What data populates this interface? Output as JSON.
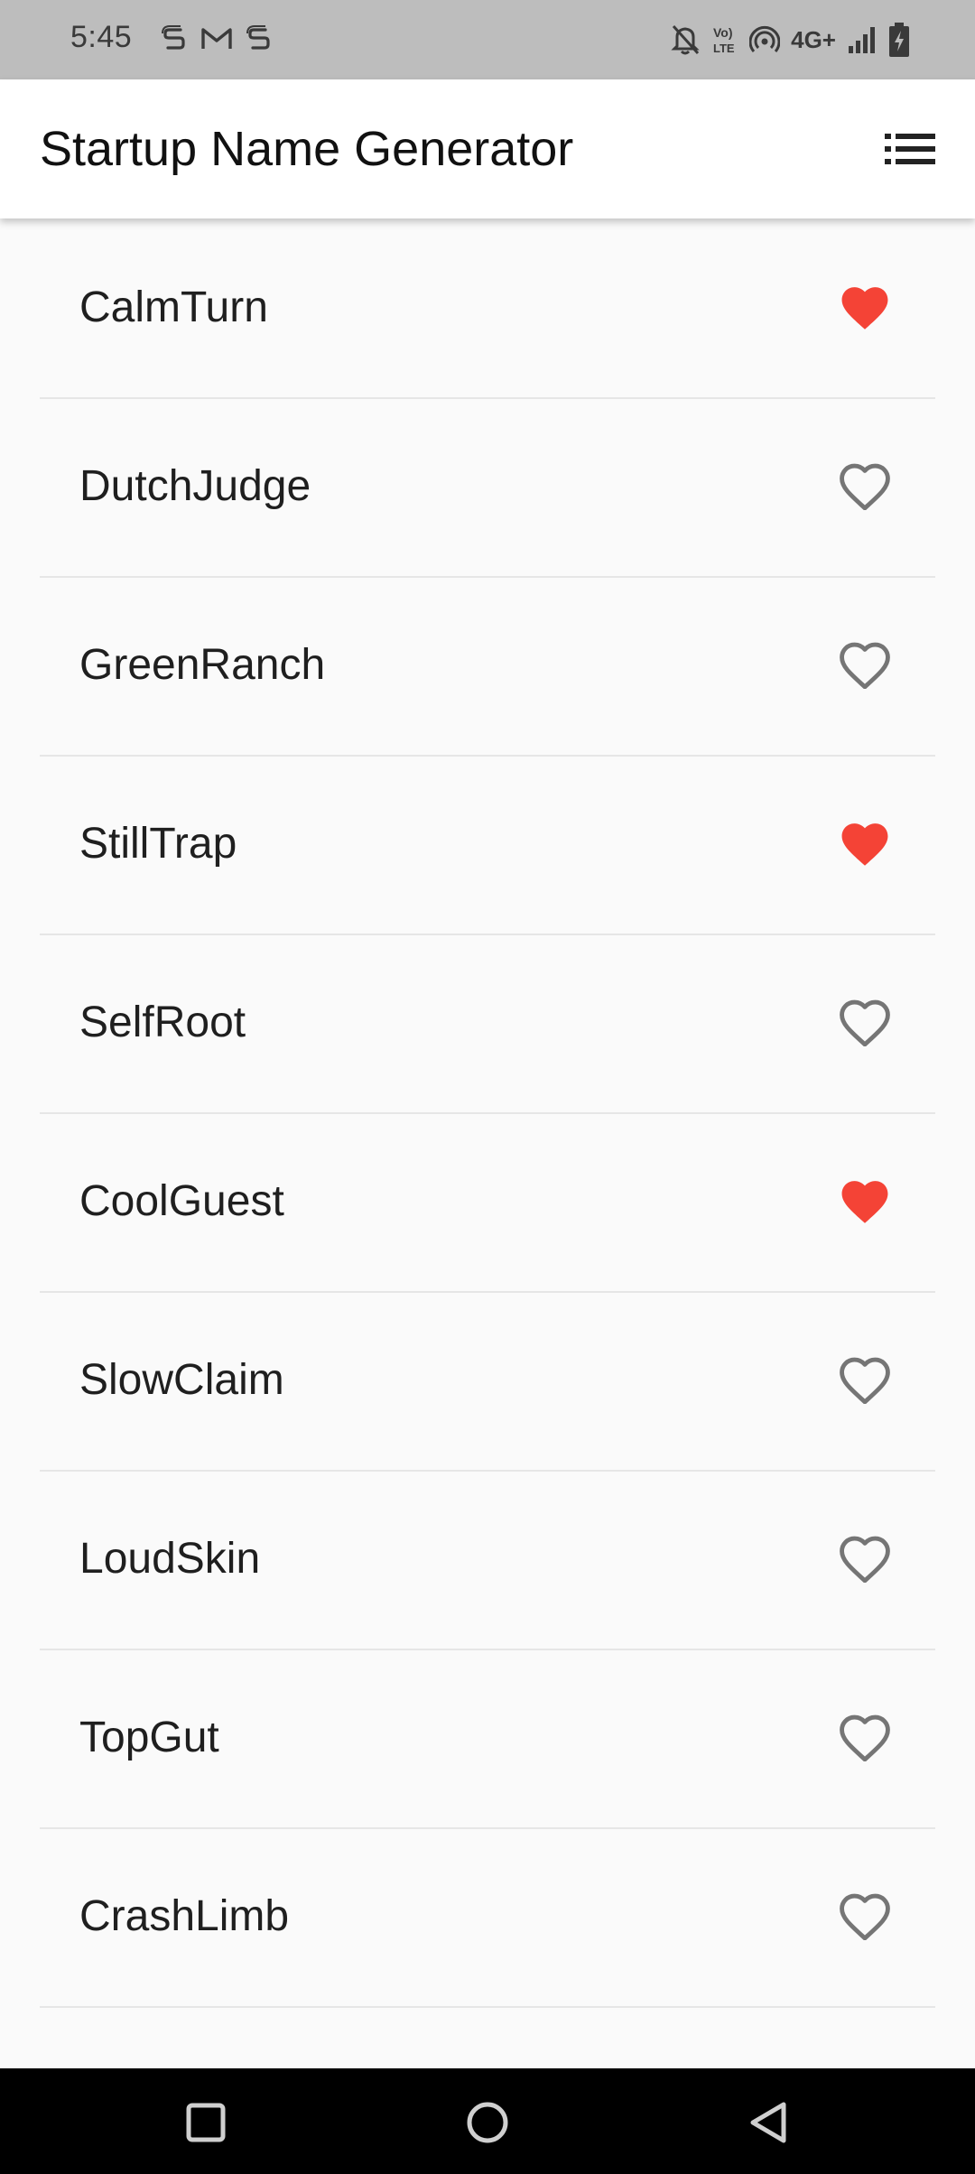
{
  "status_bar": {
    "time": "5:45",
    "network": "4G+",
    "left_icons": [
      "s-app-icon",
      "gmail-icon",
      "s-app-icon"
    ],
    "right_icons": [
      "bell-off-icon",
      "volte-icon",
      "hotspot-icon",
      "signal-icon",
      "battery-charging-icon"
    ]
  },
  "app_bar": {
    "title": "Startup Name Generator",
    "action_icon": "list-icon"
  },
  "colors": {
    "favorite": "#f44336",
    "not_favorite": "#757575",
    "status_bar": "#bdbdbd",
    "app_bar": "#ffffff",
    "background": "#fafafa",
    "nav_bar": "#000000"
  },
  "words": [
    {
      "label": "CalmTurn",
      "favorite": true
    },
    {
      "label": "DutchJudge",
      "favorite": false
    },
    {
      "label": "GreenRanch",
      "favorite": false
    },
    {
      "label": "StillTrap",
      "favorite": true
    },
    {
      "label": "SelfRoot",
      "favorite": false
    },
    {
      "label": "CoolGuest",
      "favorite": true
    },
    {
      "label": "SlowClaim",
      "favorite": false
    },
    {
      "label": "LoudSkin",
      "favorite": false
    },
    {
      "label": "TopGut",
      "favorite": false
    },
    {
      "label": "CrashLimb",
      "favorite": false
    }
  ],
  "nav_bar": {
    "buttons": [
      "recents-icon",
      "home-icon",
      "back-icon"
    ]
  }
}
